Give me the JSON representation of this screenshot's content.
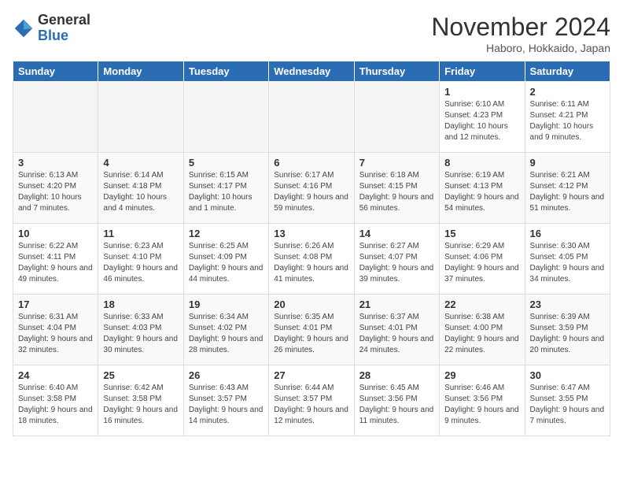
{
  "header": {
    "logo_general": "General",
    "logo_blue": "Blue",
    "month_title": "November 2024",
    "location": "Haboro, Hokkaido, Japan"
  },
  "weekdays": [
    "Sunday",
    "Monday",
    "Tuesday",
    "Wednesday",
    "Thursday",
    "Friday",
    "Saturday"
  ],
  "weeks": [
    [
      {
        "day": "",
        "info": ""
      },
      {
        "day": "",
        "info": ""
      },
      {
        "day": "",
        "info": ""
      },
      {
        "day": "",
        "info": ""
      },
      {
        "day": "",
        "info": ""
      },
      {
        "day": "1",
        "info": "Sunrise: 6:10 AM\nSunset: 4:23 PM\nDaylight: 10 hours and 12 minutes."
      },
      {
        "day": "2",
        "info": "Sunrise: 6:11 AM\nSunset: 4:21 PM\nDaylight: 10 hours and 9 minutes."
      }
    ],
    [
      {
        "day": "3",
        "info": "Sunrise: 6:13 AM\nSunset: 4:20 PM\nDaylight: 10 hours and 7 minutes."
      },
      {
        "day": "4",
        "info": "Sunrise: 6:14 AM\nSunset: 4:18 PM\nDaylight: 10 hours and 4 minutes."
      },
      {
        "day": "5",
        "info": "Sunrise: 6:15 AM\nSunset: 4:17 PM\nDaylight: 10 hours and 1 minute."
      },
      {
        "day": "6",
        "info": "Sunrise: 6:17 AM\nSunset: 4:16 PM\nDaylight: 9 hours and 59 minutes."
      },
      {
        "day": "7",
        "info": "Sunrise: 6:18 AM\nSunset: 4:15 PM\nDaylight: 9 hours and 56 minutes."
      },
      {
        "day": "8",
        "info": "Sunrise: 6:19 AM\nSunset: 4:13 PM\nDaylight: 9 hours and 54 minutes."
      },
      {
        "day": "9",
        "info": "Sunrise: 6:21 AM\nSunset: 4:12 PM\nDaylight: 9 hours and 51 minutes."
      }
    ],
    [
      {
        "day": "10",
        "info": "Sunrise: 6:22 AM\nSunset: 4:11 PM\nDaylight: 9 hours and 49 minutes."
      },
      {
        "day": "11",
        "info": "Sunrise: 6:23 AM\nSunset: 4:10 PM\nDaylight: 9 hours and 46 minutes."
      },
      {
        "day": "12",
        "info": "Sunrise: 6:25 AM\nSunset: 4:09 PM\nDaylight: 9 hours and 44 minutes."
      },
      {
        "day": "13",
        "info": "Sunrise: 6:26 AM\nSunset: 4:08 PM\nDaylight: 9 hours and 41 minutes."
      },
      {
        "day": "14",
        "info": "Sunrise: 6:27 AM\nSunset: 4:07 PM\nDaylight: 9 hours and 39 minutes."
      },
      {
        "day": "15",
        "info": "Sunrise: 6:29 AM\nSunset: 4:06 PM\nDaylight: 9 hours and 37 minutes."
      },
      {
        "day": "16",
        "info": "Sunrise: 6:30 AM\nSunset: 4:05 PM\nDaylight: 9 hours and 34 minutes."
      }
    ],
    [
      {
        "day": "17",
        "info": "Sunrise: 6:31 AM\nSunset: 4:04 PM\nDaylight: 9 hours and 32 minutes."
      },
      {
        "day": "18",
        "info": "Sunrise: 6:33 AM\nSunset: 4:03 PM\nDaylight: 9 hours and 30 minutes."
      },
      {
        "day": "19",
        "info": "Sunrise: 6:34 AM\nSunset: 4:02 PM\nDaylight: 9 hours and 28 minutes."
      },
      {
        "day": "20",
        "info": "Sunrise: 6:35 AM\nSunset: 4:01 PM\nDaylight: 9 hours and 26 minutes."
      },
      {
        "day": "21",
        "info": "Sunrise: 6:37 AM\nSunset: 4:01 PM\nDaylight: 9 hours and 24 minutes."
      },
      {
        "day": "22",
        "info": "Sunrise: 6:38 AM\nSunset: 4:00 PM\nDaylight: 9 hours and 22 minutes."
      },
      {
        "day": "23",
        "info": "Sunrise: 6:39 AM\nSunset: 3:59 PM\nDaylight: 9 hours and 20 minutes."
      }
    ],
    [
      {
        "day": "24",
        "info": "Sunrise: 6:40 AM\nSunset: 3:58 PM\nDaylight: 9 hours and 18 minutes."
      },
      {
        "day": "25",
        "info": "Sunrise: 6:42 AM\nSunset: 3:58 PM\nDaylight: 9 hours and 16 minutes."
      },
      {
        "day": "26",
        "info": "Sunrise: 6:43 AM\nSunset: 3:57 PM\nDaylight: 9 hours and 14 minutes."
      },
      {
        "day": "27",
        "info": "Sunrise: 6:44 AM\nSunset: 3:57 PM\nDaylight: 9 hours and 12 minutes."
      },
      {
        "day": "28",
        "info": "Sunrise: 6:45 AM\nSunset: 3:56 PM\nDaylight: 9 hours and 11 minutes."
      },
      {
        "day": "29",
        "info": "Sunrise: 6:46 AM\nSunset: 3:56 PM\nDaylight: 9 hours and 9 minutes."
      },
      {
        "day": "30",
        "info": "Sunrise: 6:47 AM\nSunset: 3:55 PM\nDaylight: 9 hours and 7 minutes."
      }
    ]
  ]
}
